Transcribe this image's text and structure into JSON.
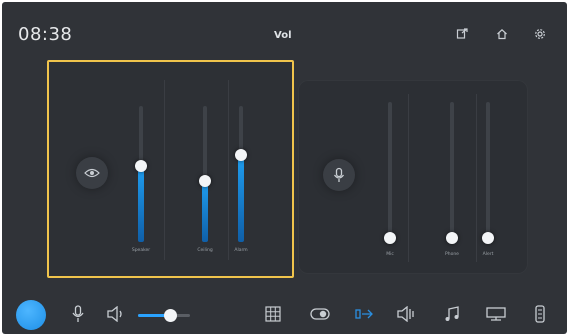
{
  "status_bar": {
    "time": "08:38",
    "date": "",
    "center_text": "Vol"
  },
  "left_panel": {
    "sliders": [
      {
        "label": "Speaker",
        "level": 0.56
      },
      {
        "label": "Ceiling",
        "level": 0.45
      },
      {
        "label": "Alarm",
        "level": 0.64
      }
    ]
  },
  "right_panel": {
    "sliders": [
      {
        "label": "Mic",
        "level": 0.0
      },
      {
        "label": "Phone",
        "level": 0.0
      },
      {
        "label": "Alert",
        "level": 0.0
      }
    ]
  },
  "dock": {
    "volume_level": 0.62,
    "icons": [
      "mic-icon",
      "speaker-icon",
      "grid-icon",
      "toggle-icon",
      "pan-icon",
      "surround-icon",
      "music-icon",
      "display-icon",
      "device-icon"
    ]
  },
  "colors": {
    "background": "#303338",
    "accent": "#1f9ef0",
    "highlight_border": "#f0c44c"
  }
}
